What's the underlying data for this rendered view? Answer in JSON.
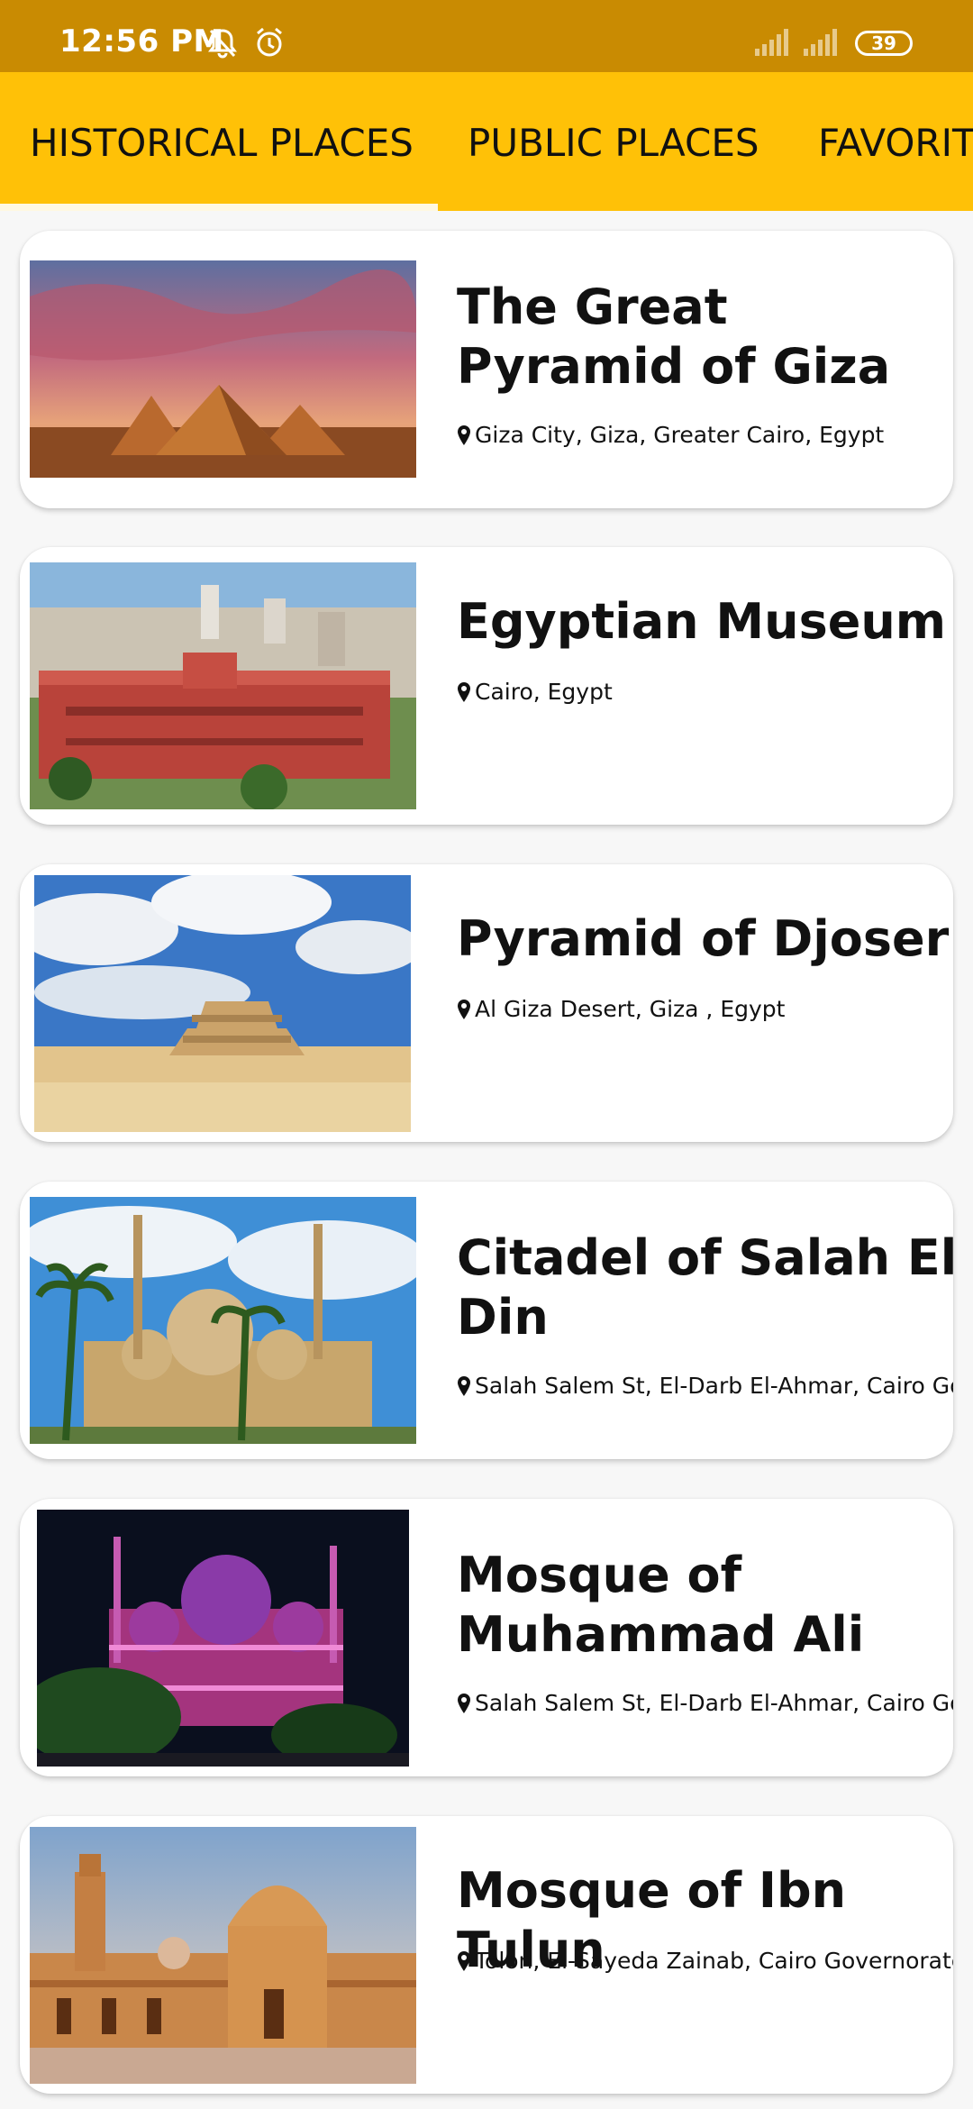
{
  "status_bar": {
    "time": "12:56 PM",
    "icons": [
      "notifications-off-icon",
      "alarm-icon",
      "signal-icon",
      "signal-icon"
    ],
    "battery": "39"
  },
  "tabs": [
    {
      "label": "HISTORICAL PLACES",
      "selected": true
    },
    {
      "label": "PUBLIC PLACES",
      "selected": false
    },
    {
      "label": "FAVORIT",
      "selected": false
    }
  ],
  "colors": {
    "status_bar": "#c98b02",
    "tab_bar": "#ffc107",
    "background": "#f7f7f7",
    "card": "#ffffff"
  },
  "places": [
    {
      "title": "The Great Pyramid of Giza",
      "location": "Giza City, Giza, Greater Cairo, Egypt",
      "image": "pyramids-at-sunset"
    },
    {
      "title": "Egyptian Museum",
      "location": "Cairo, Egypt",
      "image": "red-museum-building"
    },
    {
      "title": "Pyramid of Djoser",
      "location": "Al Giza Desert, Giza , Egypt",
      "image": "step-pyramid-desert"
    },
    {
      "title": "Citadel of Salah El Din",
      "location": "Salah Salem St, El-Darb El-Ahmar, Cairo Gov...",
      "image": "citadel-mosque-palms"
    },
    {
      "title": "Mosque of Muhammad Ali",
      "location": "Salah Salem St, El-Darb El-Ahmar, Cairo Gov...",
      "image": "mosque-at-night"
    },
    {
      "title": "Mosque of Ibn Tulun",
      "location": "Tolon, El-Sayeda Zainab, Cairo Governorate",
      "image": "mosque-courtyard-dome"
    }
  ]
}
